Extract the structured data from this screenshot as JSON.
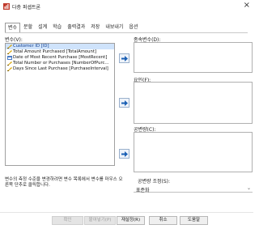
{
  "window": {
    "title": "다층 퍼셉트론",
    "close_glyph": "×"
  },
  "tabs": [
    {
      "label": "변수"
    },
    {
      "label": "분할"
    },
    {
      "label": "설계"
    },
    {
      "label": "학습"
    },
    {
      "label": "출력결과"
    },
    {
      "label": "저장"
    },
    {
      "label": "내보내기"
    },
    {
      "label": "옵션"
    }
  ],
  "variables": {
    "label": "변수(V):",
    "items": [
      {
        "label": "Customer ID [ID]",
        "selected": true
      },
      {
        "label": "Total Amount Purchased [TotalAmount]",
        "selected": false
      },
      {
        "label": "Date of Most Recent Purchase [MostRecent]",
        "selected": false
      },
      {
        "label": "Total Number or Purchases [NumberOfPurc...",
        "selected": false
      },
      {
        "label": "Days Since Last Purchase [PurchaseInterval]",
        "selected": false
      }
    ]
  },
  "dependent": {
    "label": "종속변수(D):"
  },
  "factors": {
    "label": "요인(F):"
  },
  "covariates": {
    "label": "공변량(C):"
  },
  "hint": {
    "text": "변수의 측정 수준을 변경하려면 변수 목록에서 변수를 마우스 오른쪽 단추로 클릭합니다."
  },
  "rescale": {
    "label": "공변량 조정(S):",
    "value": "표준화"
  },
  "buttons": {
    "ok": "확인",
    "paste": "붙여넣기(P)",
    "reset": "재설정(R)",
    "cancel": "취소",
    "help": "도움말"
  },
  "colors": {
    "accent": "#1a5fb4",
    "selection": "#cfe3fb"
  }
}
